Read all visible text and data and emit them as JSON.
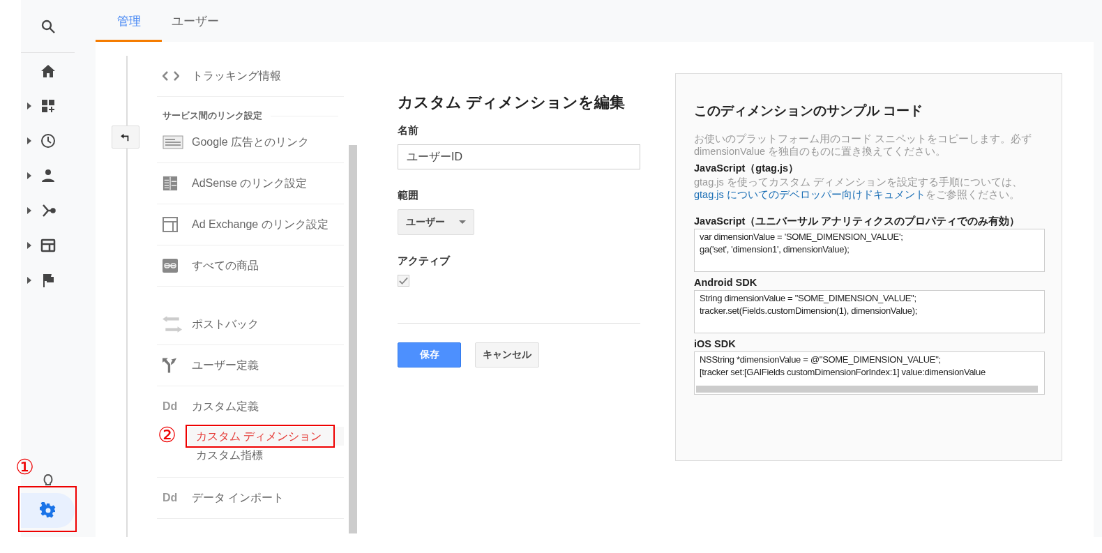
{
  "rail": [
    {
      "expandable": false,
      "selected": false
    },
    {
      "expandable": false,
      "selected": false
    },
    {
      "expandable": true,
      "selected": false
    },
    {
      "expandable": true,
      "selected": false
    },
    {
      "expandable": true,
      "selected": false
    },
    {
      "expandable": true,
      "selected": false
    },
    {
      "expandable": true,
      "selected": false
    },
    {
      "expandable": true,
      "selected": false
    },
    {
      "expandable": false,
      "selected": false
    },
    {
      "expandable": false,
      "selected": true,
      "callout": "①"
    }
  ],
  "tabs": [
    {
      "label": "管理",
      "selected": true
    },
    {
      "label": "ユーザー",
      "selected": false
    }
  ],
  "nav": [
    {
      "kind": "item",
      "label": "トラッキング情報"
    },
    {
      "kind": "section",
      "label": "サービス間のリンク設定"
    },
    {
      "kind": "item",
      "label": "Google 広告とのリンク"
    },
    {
      "kind": "item",
      "label": "AdSense のリンク設定"
    },
    {
      "kind": "item",
      "label": "Ad Exchange のリンク設定"
    },
    {
      "kind": "item",
      "label": "すべての商品"
    },
    {
      "kind": "spacer"
    },
    {
      "kind": "item",
      "label": "ポストバック"
    },
    {
      "kind": "item",
      "label": "ユーザー定義"
    },
    {
      "kind": "item",
      "icon_text": "Dd",
      "label": "カスタム定義",
      "children": [
        {
          "label": "カスタム ディメンション",
          "selected": true,
          "callout": "②"
        },
        {
          "label": "カスタム指標",
          "selected": false
        }
      ]
    },
    {
      "kind": "item",
      "icon_text": "Dd",
      "label": "データ インポート"
    }
  ],
  "form": {
    "title": "カスタム ディメンションを編集",
    "name_label": "名前",
    "name_value": "ユーザーID",
    "scope_label": "範囲",
    "scope_value": "ユーザー",
    "active_label": "アクティブ",
    "active_checked": true,
    "disabled": true,
    "save": "保存",
    "cancel": "キャンセル"
  },
  "sample": {
    "title": "このディメンションのサンプル コード",
    "intro": "お使いのプラットフォーム用のコード スニペットをコピーします。必ず dimensionValue を独自のものに置き換えてください。",
    "gtag_heading": "JavaScript（gtag.js）",
    "gtag_before": "gtag.js を使ってカスタム ディメンションを設定する手順については、",
    "gtag_link": "gtag.js についてのデベロッパー向けドキュメント",
    "gtag_after": "をご参照ください。",
    "snippets": [
      {
        "heading": "JavaScript（ユニバーサル アナリティクスのプロパティでのみ有効）",
        "lines": [
          "var dimensionValue = 'SOME_DIMENSION_VALUE';",
          "ga('set', 'dimension1', dimensionValue);"
        ],
        "scrollbar": false
      },
      {
        "heading": "Android SDK",
        "lines": [
          "String dimensionValue = \"SOME_DIMENSION_VALUE\";",
          "tracker.set(Fields.customDimension(1), dimensionValue);"
        ],
        "scrollbar": false
      },
      {
        "heading": "iOS SDK",
        "lines": [
          "NSString *dimensionValue = @\"SOME_DIMENSION_VALUE\";",
          "[tracker set:[GAIFields customDimensionForIndex:1] value:dimensionValue"
        ],
        "scrollbar": true
      }
    ]
  }
}
